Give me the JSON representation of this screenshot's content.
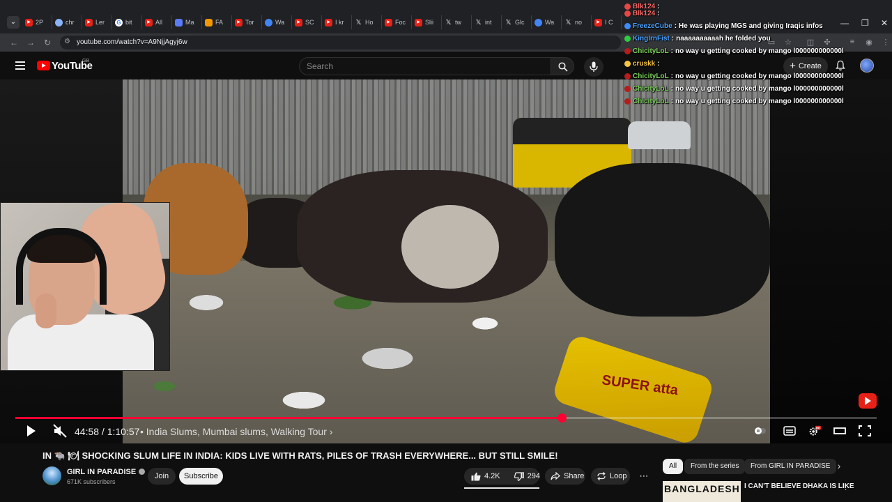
{
  "browser": {
    "tabs": [
      {
        "label": "2P",
        "icon": "youtube-icon",
        "kind": "yt"
      },
      {
        "label": "chr",
        "icon": "chrome-icon",
        "kind": "ch"
      },
      {
        "label": "Ler",
        "icon": "youtube-icon",
        "kind": "yt"
      },
      {
        "label": "bit",
        "icon": "google-icon",
        "kind": "g"
      },
      {
        "label": "All",
        "icon": "youtube-icon",
        "kind": "yt"
      },
      {
        "label": "Ma",
        "icon": "mail-icon",
        "kind": "m"
      },
      {
        "label": "FA",
        "icon": "fa-icon",
        "kind": "o"
      },
      {
        "label": "Tor",
        "icon": "youtube-icon",
        "kind": "yt"
      },
      {
        "label": "Wa",
        "icon": "web-icon",
        "kind": "w"
      },
      {
        "label": "SC",
        "icon": "youtube-icon",
        "kind": "yt"
      },
      {
        "label": "I kr",
        "icon": "youtube-icon",
        "kind": "yt"
      },
      {
        "label": "Ho",
        "icon": "x-icon",
        "kind": "x"
      },
      {
        "label": "Foc",
        "icon": "youtube-icon",
        "kind": "yt"
      },
      {
        "label": "Slii",
        "icon": "youtube-icon",
        "kind": "yt"
      },
      {
        "label": "tw",
        "icon": "x-icon",
        "kind": "x"
      },
      {
        "label": "int",
        "icon": "x-icon",
        "kind": "x"
      },
      {
        "label": "Glc",
        "icon": "x-icon",
        "kind": "x"
      },
      {
        "label": "Wa",
        "icon": "web-icon",
        "kind": "w"
      },
      {
        "label": "no",
        "icon": "x-icon",
        "kind": "x"
      },
      {
        "label": "I C",
        "icon": "youtube-icon",
        "kind": "yt"
      }
    ],
    "url": "youtube.com/watch?v=A9NjjAgyj6w"
  },
  "youtube": {
    "logo_text": "YouTube",
    "country_code": "GB",
    "search_placeholder": "Search",
    "create_label": "Create"
  },
  "player": {
    "current_time": "44:58",
    "duration": "1:10:57",
    "time_display": "44:58 / 1:10:57",
    "chapter": "• India Slums, Mumbai slums, Walking Tour ›",
    "progress_fraction": 0.634,
    "video_text": "SUPER atta",
    "muted": true
  },
  "chat": [
    {
      "user": "Blk124",
      "message": "",
      "color": "#ff6b6b",
      "badge": "#e84545"
    },
    {
      "user": "Blk124",
      "message": "",
      "color": "#ff6b6b",
      "badge": "#e84545"
    },
    {
      "user": "FreezeCube",
      "message": "He was playing MGS and giving Iraqis infos",
      "color": "#4aa3ff",
      "badge": "#3d8bff"
    },
    {
      "user": "KingIrnFist",
      "message": "naaaaaaaaaah he folded you",
      "color": "#4aa3ff",
      "badge": "#2ecc40"
    },
    {
      "user": "ChicityLoL",
      "message": "no way u getting cooked by mango l000000000000l",
      "color": "#7bd35b",
      "badge": "#b71c1c"
    },
    {
      "user": "cruskk",
      "message": "",
      "color": "#f5c542",
      "badge": "#f5c542"
    },
    {
      "user": "ChicityLoL",
      "message": "no way u getting cooked by mango l000000000000l",
      "color": "#7bd35b",
      "badge": "#b71c1c"
    },
    {
      "user": "ChicityLoL",
      "message": "no way u getting cooked by mango l000000000000l",
      "color": "#7bd35b",
      "badge": "#b71c1c"
    },
    {
      "user": "ChicityLoL",
      "message": "no way u getting cooked by mango l000000000000l",
      "color": "#7bd35b",
      "badge": "#b71c1c"
    }
  ],
  "video": {
    "title": "IN 🐃 🍽 SHOCKING SLUM LIFE IN INDIA: KIDS LIVE WITH RATS, PILES OF TRASH EVERYWHERE... BUT STILL SMILE!",
    "channel": "GIRL IN PARADISE",
    "subscribers": "671K subscribers",
    "join_label": "Join",
    "subscribe_label": "Subscribe",
    "likes": "4.2K",
    "dislikes": "294",
    "share_label": "Share",
    "loop_label": "Loop",
    "more_label": "⋯"
  },
  "recommendations": {
    "chips": [
      {
        "label": "All",
        "active": true
      },
      {
        "label": "From the series",
        "active": false
      },
      {
        "label": "From GIRL IN PARADISE",
        "active": false
      }
    ],
    "first_thumb_text": "BANGLADESH",
    "first_title": "I CAN'T BELIEVE DHAKA IS LIKE"
  }
}
